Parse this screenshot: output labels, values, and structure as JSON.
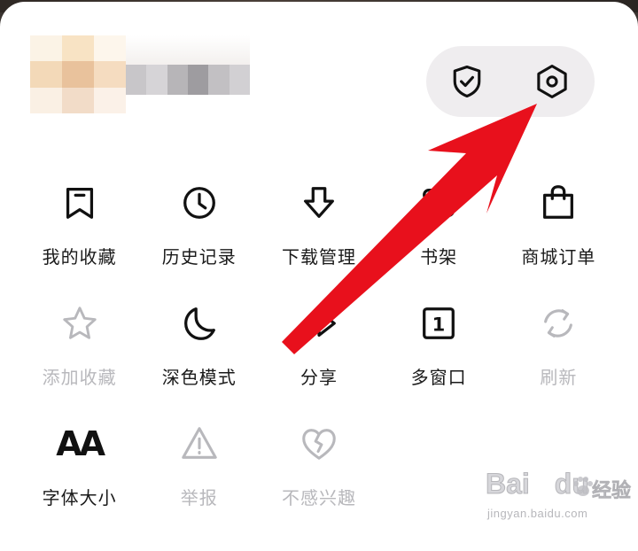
{
  "header": {
    "shield_icon": "shield-check-icon",
    "settings_icon": "hexagon-settings-icon"
  },
  "menu": {
    "items": [
      {
        "label": "我的收藏",
        "icon": "bookmark-icon",
        "enabled": true
      },
      {
        "label": "历史记录",
        "icon": "clock-icon",
        "enabled": true
      },
      {
        "label": "下载管理",
        "icon": "download-arrow-icon",
        "enabled": true
      },
      {
        "label": "书架",
        "icon": "bookshelf-icon",
        "enabled": true
      },
      {
        "label": "商城订单",
        "icon": "shopping-bag-icon",
        "enabled": true
      },
      {
        "label": "添加收藏",
        "icon": "star-icon",
        "enabled": false
      },
      {
        "label": "深色模式",
        "icon": "moon-icon",
        "enabled": true
      },
      {
        "label": "分享",
        "icon": "share-icon",
        "enabled": true
      },
      {
        "label": "多窗口",
        "icon": "window-count-icon",
        "enabled": true,
        "badge": "1"
      },
      {
        "label": "刷新",
        "icon": "refresh-icon",
        "enabled": false
      },
      {
        "label": "字体大小",
        "icon": "font-size-icon",
        "enabled": true,
        "glyph": "AA"
      },
      {
        "label": "举报",
        "icon": "warning-icon",
        "enabled": false
      },
      {
        "label": "不感兴趣",
        "icon": "broken-heart-icon",
        "enabled": false
      }
    ]
  },
  "colors": {
    "sheet_bg": "#ffffff",
    "pill_bg": "#efedef",
    "icon_active": "#111111",
    "icon_disabled": "#b8b8bc",
    "label_active": "#1a1a1a",
    "label_disabled": "#b8b8bc",
    "annotation_arrow": "#e8101c"
  },
  "watermark": {
    "brand": "Bai",
    "brand_suffix": "du",
    "cn": "经验",
    "url": "jingyan.baidu.com"
  }
}
